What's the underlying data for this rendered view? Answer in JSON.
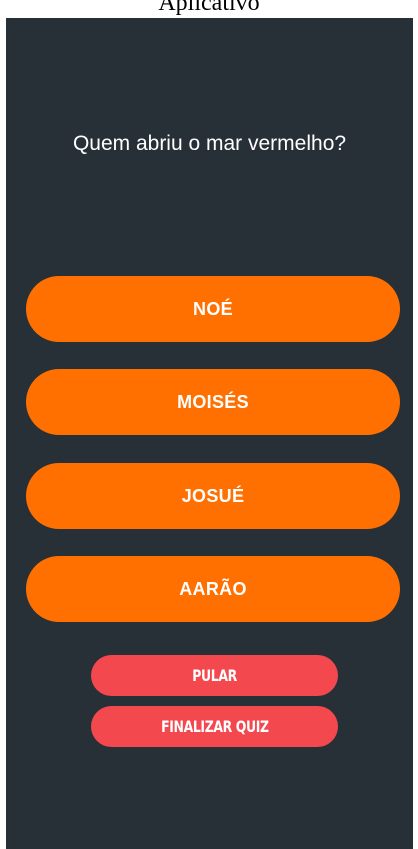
{
  "window": {
    "caption": "Aplicativo"
  },
  "quiz": {
    "question": "Quem abriu o mar vermelho?",
    "answers": [
      "NOÉ",
      "MOISÉS",
      "JOSUÉ",
      "AARÃO"
    ],
    "skip_label": "PULAR",
    "finish_label": "FINALIZAR QUIZ"
  },
  "colors": {
    "background": "#263036",
    "answer_button": "#ff7000",
    "action_button": "#f4484f",
    "text": "#ffffff"
  }
}
